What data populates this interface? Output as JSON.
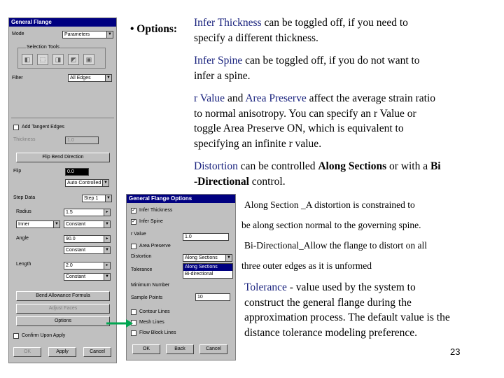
{
  "flange_panel": {
    "title": "General Flange",
    "mode_label": "Mode",
    "mode_value": "Parameters",
    "selection_label": "Selection Tools",
    "filter_label": "Filter",
    "filter_value": "All Edges",
    "add_tangent_edges": "Add Tangent Edges",
    "thickness_label": "Thickness",
    "thickness_value": "1.0",
    "flip_button": "Flip Bend Direction",
    "flip_row_label": "Flip",
    "flip_value1": "0.0",
    "flip_value2": "Auto Controlled",
    "step_data_label": "Step Data",
    "step_value": "Step 1",
    "radius_label": "Radius",
    "radius_value": "1.5",
    "radius_side": "Inner",
    "radius_mode": "Constant",
    "angle_label": "Angle",
    "angle_value": "90.0",
    "angle_mode": "Constant",
    "length_label": "Length",
    "length_value": "2.0",
    "length_mode": "Constant",
    "bend_allowance_button": "Bend Allowance Formula",
    "adjust_faces_button": "Adjust Faces",
    "options_button": "Options",
    "confirm_label": "Confirm Upon Apply",
    "ok_button": "OK",
    "apply_button": "Apply",
    "cancel_button": "Cancel"
  },
  "options_dialog": {
    "title": "General Flange Options",
    "infer_thickness": "Infer Thickness",
    "infer_spine": "Infer Spine",
    "r_value_label": "r Value",
    "r_value": "1.0",
    "area_preserve": "Area Preserve",
    "distortion_label": "Distortion",
    "distortion_value": "Along Sections",
    "distortion_options": [
      "Along Sections",
      "Bi-directional"
    ],
    "tolerance_label": "Tolerance",
    "min_number_label": "Minimum Number",
    "sample_points_label": "Sample Points",
    "sample_points_value": "10",
    "contour_lines": "Contour Lines",
    "mesh_lines": "Mesh Lines",
    "flow_block_lines": "Flow Block Lines",
    "ok_button": "OK",
    "back_button": "Back",
    "cancel_button": "Cancel"
  },
  "slide_text": {
    "options_heading": "• Options:",
    "infer_thickness_kw": "Infer Thickness",
    "infer_thickness_rest": " can be toggled off, if you need to",
    "infer_thickness_line2": "specify a different thickness.",
    "infer_spine_kw": "Infer Spine",
    "infer_spine_rest": " can be toggled off, if you do not want to",
    "infer_spine_line2": "infer a spine.",
    "rvalue_kw": "r Value",
    "rvalue_and": " and ",
    "area_kw": "Area Preserve",
    "rvalue_rest": " affect the average strain ratio",
    "rvalue_line2": "to normal anisotropy. You can specify an r Value or",
    "rvalue_line3": "toggle Area Preserve ON, which is equivalent to",
    "rvalue_line4": "specifying an infinite r value.",
    "distortion_kw": "Distortion",
    "distortion_mid": " can be controlled ",
    "along_sections_bold": "Along Sections",
    "distortion_mid2": " or with a ",
    "bi_bold": "Bi",
    "bidirectional_bold": "-Directional",
    "distortion_end": " control.",
    "along_section_line1": "Along Section _A distortion is constrained to",
    "along_section_line2": "be along section normal to the governing spine.",
    "bidirectional_line1": "Bi-Directional_Allow the flange to distort on all",
    "bidirectional_line2": "three outer edges as it is unformed",
    "tolerance_kw": "Tolerance",
    "tolerance_rest": " - value used by the system to",
    "tolerance_line2": "construct the general flange during the",
    "tolerance_line3": "approximation process. The default value is the",
    "tolerance_line4": "distance tolerance modeling preference.",
    "page_number": "23"
  },
  "colors": {
    "keyword": "#1a237e",
    "titlebar": "#000080",
    "panel": "#c0c0c0",
    "arrow": "#00a651"
  }
}
